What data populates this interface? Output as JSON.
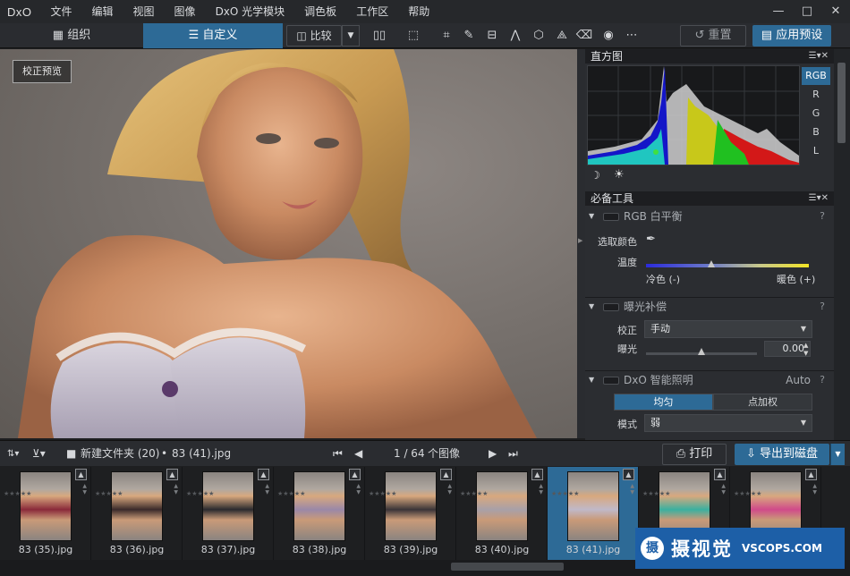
{
  "app": {
    "logo": "DxO",
    "menu": [
      "文件",
      "编辑",
      "视图",
      "图像",
      "DxO 光学模块",
      "调色板",
      "工作区",
      "帮助"
    ],
    "window_controls": {
      "minimize": "—",
      "maximize": "□",
      "close": "✕"
    }
  },
  "toolbar": {
    "tab_organize": "组织",
    "tab_customize": "自定义",
    "compare": "比较",
    "reset": "重置",
    "apply_preset": "应用预设"
  },
  "viewer": {
    "proof_button": "校正预览"
  },
  "panel": {
    "histogram": {
      "title": "直方图",
      "channels": [
        "RGB",
        "R",
        "G",
        "B",
        "L"
      ]
    },
    "essential_tools": {
      "title": "必备工具",
      "wb": {
        "title": "RGB 白平衡",
        "pick_color": "选取颜色",
        "temperature": "温度",
        "cool": "冷色 (-)",
        "warm": "暖色 (+)",
        "temperature_level": 0.4
      },
      "exposure": {
        "title": "曝光补偿",
        "correction_label": "校正",
        "correction_value": "手动",
        "exposure_label": "曝光",
        "exposure_value": "0.00",
        "exposure_level": 0.5
      },
      "lighting": {
        "title": "DxO 智能照明",
        "status": "Auto",
        "mode_uniform": "均匀",
        "mode_spot": "点加权",
        "mode_label": "模式",
        "mode_value": "弱"
      },
      "help": "?"
    }
  },
  "filmstrip_bar": {
    "folder": "新建文件夹 (20)",
    "separator": "•",
    "current_file": "83 (41).jpg",
    "page": "1 / 64",
    "image_count": "个图像",
    "print": "打印",
    "export": "导出到磁盘"
  },
  "filmstrip": {
    "thumbnails": [
      {
        "name": "83 (35).jpg",
        "color": "#8a2a3a",
        "selected": false
      },
      {
        "name": "83 (36).jpg",
        "color": "#3a2a2a",
        "selected": false
      },
      {
        "name": "83 (37).jpg",
        "color": "#2a2a2e",
        "selected": false
      },
      {
        "name": "83 (38).jpg",
        "color": "#9a88a8",
        "selected": false
      },
      {
        "name": "83 (39).jpg",
        "color": "#3a3438",
        "selected": false
      },
      {
        "name": "83 (40).jpg",
        "color": "#a8a0a8",
        "selected": false
      },
      {
        "name": "83 (41).jpg",
        "color": "#c0b8c8",
        "selected": true
      },
      {
        "name": "",
        "color": "#3ab0a0",
        "selected": false
      },
      {
        "name": "",
        "color": "#d04a8a",
        "selected": false
      }
    ]
  },
  "watermark": {
    "logo_char": "摄",
    "name": "摄视觉",
    "domain": "VSCOPS.COM"
  },
  "colors": {
    "accent": "#2d6a96",
    "background": "#1e1f21",
    "panel": "#2b2d31"
  }
}
